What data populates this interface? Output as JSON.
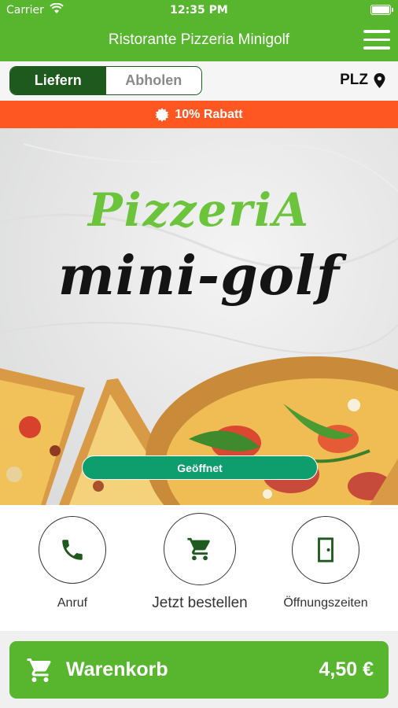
{
  "status_bar": {
    "carrier": "Carrier",
    "time": "12:35 PM"
  },
  "header": {
    "title": "Ristorante Pizzeria Minigolf"
  },
  "mode": {
    "deliver_label": "Liefern",
    "pickup_label": "Abholen",
    "active": "deliver",
    "plz_label": "PLZ"
  },
  "discount": {
    "text": "10% Rabatt"
  },
  "hero": {
    "logo_line1": "PizzeriA",
    "logo_line2": "mini-golf",
    "status": "Geöffnet"
  },
  "actions": [
    {
      "label": "Anruf",
      "icon": "phone-icon"
    },
    {
      "label": "Jetzt bestellen",
      "icon": "cart-icon"
    },
    {
      "label": "Öffnungszeiten",
      "icon": "door-icon"
    }
  ],
  "cart": {
    "label": "Warenkorb",
    "total": "4,50 €"
  },
  "colors": {
    "brand_green": "#57b52e",
    "dark_green": "#1e5a1e",
    "discount_orange": "#ff5722",
    "open_teal": "#0e9e6e"
  }
}
